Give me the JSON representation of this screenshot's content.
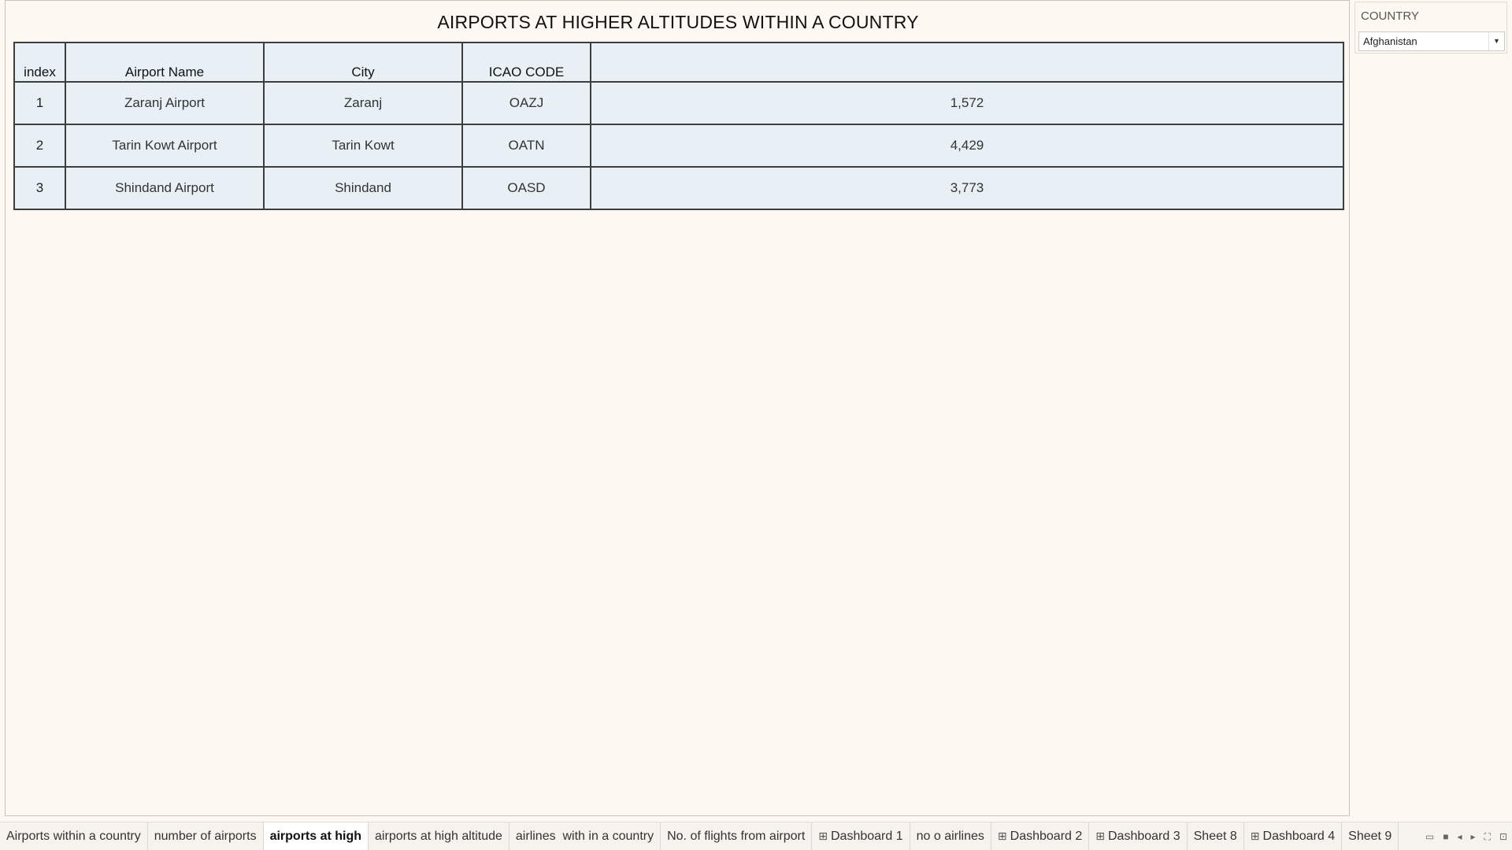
{
  "sheet": {
    "title": "AIRPORTS AT HIGHER ALTITUDES WITHIN A COUNTRY"
  },
  "table": {
    "headers": [
      "index",
      "Airport Name",
      "City",
      "ICAO CODE",
      ""
    ],
    "rows": [
      [
        "1",
        "Zaranj Airport",
        "Zaranj",
        "OAZJ",
        "1,572"
      ],
      [
        "2",
        "Tarin Kowt Airport",
        "Tarin Kowt",
        "OATN",
        "4,429"
      ],
      [
        "3",
        "Shindand Airport",
        "Shindand",
        "OASD",
        "3,773"
      ]
    ]
  },
  "filter": {
    "title": "COUNTRY",
    "value": "Afghanistan",
    "arrow_icon": "dropdown-arrow-icon"
  },
  "tabs": [
    {
      "label": "Airports within a country",
      "type": "sheet"
    },
    {
      "label": "number of airports",
      "type": "sheet"
    },
    {
      "label": "airports at high",
      "type": "sheet",
      "active": true
    },
    {
      "label": "airports at high altitude",
      "type": "sheet"
    },
    {
      "label": "airlines  with in a country",
      "type": "sheet"
    },
    {
      "label": "No. of flights from airport",
      "type": "sheet"
    },
    {
      "label": "Dashboard 1",
      "type": "dashboard"
    },
    {
      "label": "no o airlines",
      "type": "sheet"
    },
    {
      "label": "Dashboard 2",
      "type": "dashboard"
    },
    {
      "label": "Dashboard 3",
      "type": "dashboard"
    },
    {
      "label": "Sheet 8",
      "type": "sheet"
    },
    {
      "label": "Dashboard 4",
      "type": "dashboard"
    },
    {
      "label": "Sheet 9",
      "type": "sheet"
    }
  ],
  "colors": {
    "background": "#fdf8f2",
    "table_cell": "#e8f0f6",
    "table_border": "#3d3d3d"
  }
}
